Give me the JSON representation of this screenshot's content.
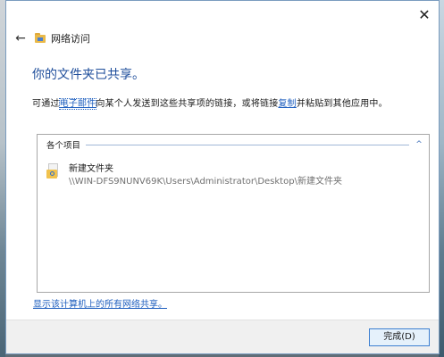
{
  "window": {
    "close_glyph": "✕"
  },
  "nav": {
    "back_glyph": "←",
    "title": "网络访问"
  },
  "main": {
    "heading": "你的文件夹已共享。",
    "desc_before": "可通过",
    "desc_email_link": "电子邮件",
    "desc_middle": "向某个人发送到这些共享项的链接，或将链接",
    "desc_copy_link": "复制",
    "desc_after": "并粘贴到其他应用中。"
  },
  "list": {
    "group_label": "各个项目",
    "collapse_glyph": "^",
    "items": [
      {
        "name": "新建文件夹",
        "path": "\\\\WIN-DFS9NUNV69K\\Users\\Administrator\\Desktop\\新建文件夹"
      }
    ]
  },
  "footer": {
    "show_all_link": "显示该计算机上的所有网络共享。"
  },
  "buttons": {
    "done_label": "完成(D)"
  },
  "colors": {
    "heading": "#1f4e9b",
    "link": "#1f5fbf",
    "folder": "#f1c24d",
    "button_border": "#3c7fd1",
    "button_fill": "#e5f1fb"
  }
}
